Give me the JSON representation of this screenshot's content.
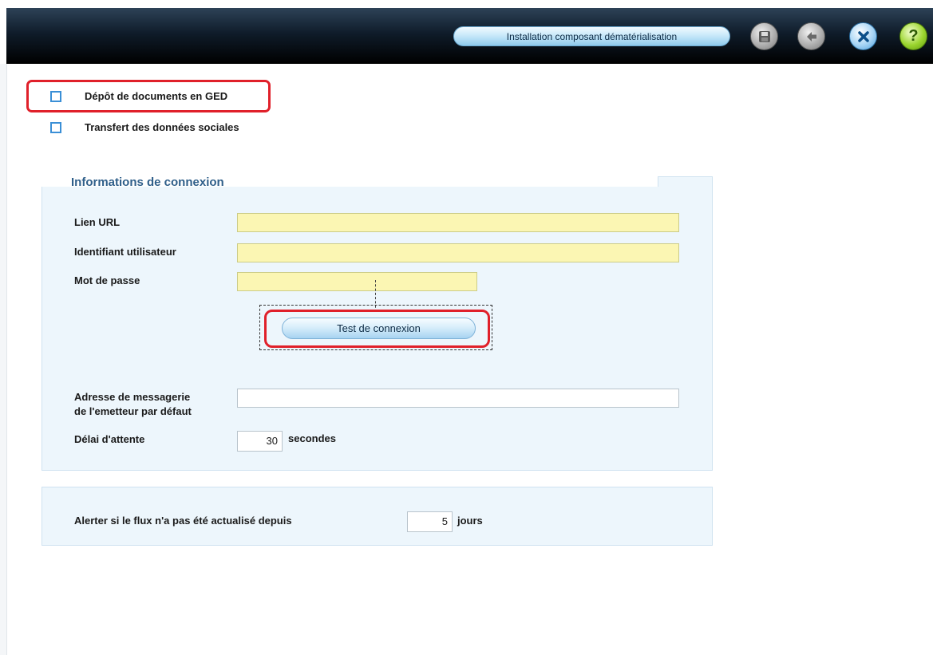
{
  "header": {
    "title": "Installation composant dématérialisation",
    "buttons": [
      {
        "name": "save-icon"
      },
      {
        "name": "back-icon"
      },
      {
        "name": "close-icon"
      },
      {
        "name": "help-icon",
        "glyph": "?"
      }
    ]
  },
  "options": {
    "ged_label": "Dépôt de documents en GED",
    "ged_checked": false,
    "social_label": "Transfert des données sociales",
    "social_checked": false
  },
  "connection": {
    "legend": "Informations de connexion",
    "url_label": "Lien URL",
    "url_value": "",
    "user_label": "Identifiant utilisateur",
    "user_value": "",
    "password_label": "Mot de passe",
    "password_value": "",
    "test_button": "Test de connexion",
    "email_label_line1": "Adresse de messagerie",
    "email_label_line2": "de l'emetteur par défaut",
    "email_value": "",
    "timeout_label": "Délai d'attente",
    "timeout_value": "30",
    "timeout_unit": "secondes"
  },
  "alert": {
    "label": "Alerter si le flux n'a pas été actualisé depuis",
    "value": "5",
    "unit": "jours"
  },
  "colors": {
    "highlight_frame": "#e0202a",
    "required_field": "#fbf6b3",
    "panel_bg": "#edf6fc",
    "legend_text": "#2f5f8a"
  }
}
